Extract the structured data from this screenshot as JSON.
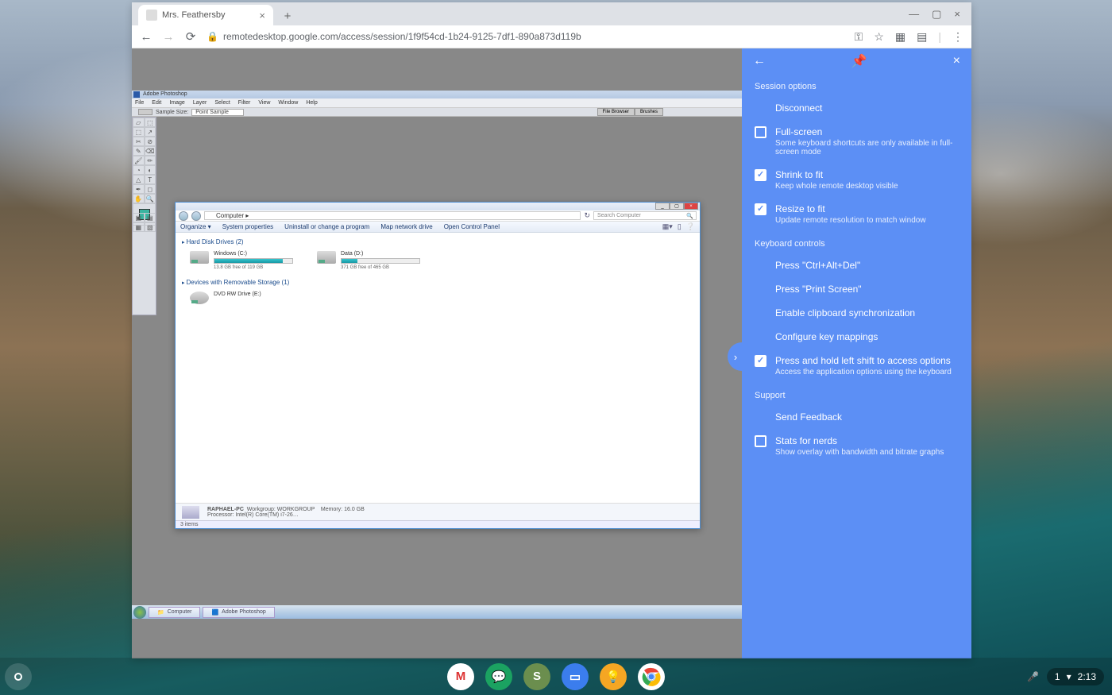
{
  "browser": {
    "tab_title": "Mrs. Feathersby",
    "url": "remotedesktop.google.com/access/session/1f9f54cd-1b24-9125-7df1-890a873d119b"
  },
  "photoshop": {
    "title": "Adobe Photoshop",
    "menu": [
      "File",
      "Edit",
      "Image",
      "Layer",
      "Select",
      "Filter",
      "View",
      "Window",
      "Help"
    ],
    "sample_label": "Sample Size:",
    "sample_value": "Point Sample",
    "tab1": "File Browser",
    "tab2": "Brushes"
  },
  "explorer": {
    "path": "Computer ▸",
    "search_placeholder": "Search Computer",
    "toolbar": [
      "Organize ▾",
      "System properties",
      "Uninstall or change a program",
      "Map network drive",
      "Open Control Panel"
    ],
    "group1": "Hard Disk Drives (2)",
    "group2": "Devices with Removable Storage (1)",
    "drive_c": {
      "name": "Windows (C:)",
      "free": "13.8 GB free of 119 GB",
      "fill": 88
    },
    "drive_d": {
      "name": "Data (D:)",
      "free": "371 GB free of 465 GB",
      "fill": 20
    },
    "dvd": "DVD RW Drive (E:)",
    "status": {
      "pc": "RAPHAEL-PC",
      "wg_label": "Workgroup:",
      "wg": "WORKGROUP",
      "mem_label": "Memory:",
      "mem": "16.0 GB",
      "proc_label": "Processor:",
      "proc": "Intel(R) Core(TM) i7-26…"
    },
    "items": "3 items"
  },
  "taskbar": {
    "btn1": "Computer",
    "btn2": "Adobe Photoshop"
  },
  "rd": {
    "s1": "Session options",
    "disconnect": "Disconnect",
    "fullscreen": "Full-screen",
    "fullscreen_sub": "Some keyboard shortcuts are only available in full-screen mode",
    "shrink": "Shrink to fit",
    "shrink_sub": "Keep whole remote desktop visible",
    "resize": "Resize to fit",
    "resize_sub": "Update remote resolution to match window",
    "s2": "Keyboard controls",
    "cad": "Press \"Ctrl+Alt+Del\"",
    "ps": "Press \"Print Screen\"",
    "clip": "Enable clipboard synchronization",
    "keymap": "Configure key mappings",
    "shift": "Press and hold left shift to access options",
    "shift_sub": "Access the application options using the keyboard",
    "s3": "Support",
    "feedback": "Send Feedback",
    "stats": "Stats for nerds",
    "stats_sub": "Show overlay with bandwidth and bitrate graphs"
  },
  "shelf": {
    "time": "2:13",
    "notif": "1"
  }
}
